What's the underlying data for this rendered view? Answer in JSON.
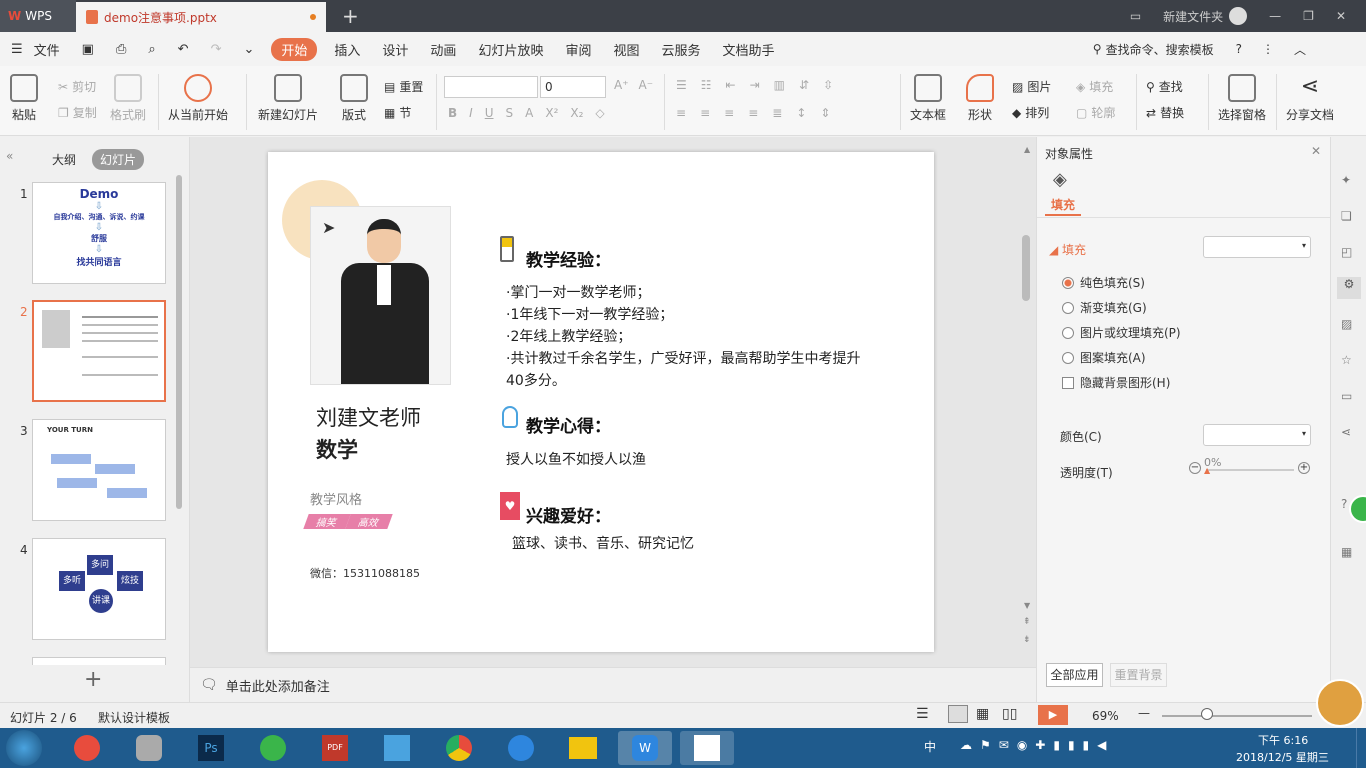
{
  "titlebar": {
    "app": "WPS",
    "doc_tab": "demo注意事项.pptx",
    "new_folder": "新建文件夹"
  },
  "menubar": {
    "file": "文件",
    "items": [
      "开始",
      "插入",
      "设计",
      "动画",
      "幻灯片放映",
      "审阅",
      "视图",
      "云服务",
      "文档助手"
    ],
    "search": "查找命令、搜索模板"
  },
  "ribbon": {
    "paste": "粘贴",
    "cut": "剪切",
    "copy": "复制",
    "format_painter": "格式刷",
    "from_current": "从当前开始",
    "new_slide": "新建幻灯片",
    "layout": "版式",
    "reset": "重置",
    "section": "节",
    "font_size": "0",
    "textbox": "文本框",
    "shape": "形状",
    "picture": "图片",
    "fill": "填充",
    "arrange": "排列",
    "outline": "轮廓",
    "find": "查找",
    "replace": "替换",
    "selection_pane": "选择窗格",
    "share": "分享文档"
  },
  "left_panel": {
    "tab_outline": "大纲",
    "tab_slides": "幻灯片",
    "slides": [
      {
        "num": "1",
        "title": "Demo",
        "line1": "自我介绍、沟通、诉说、约课",
        "line2": "舒服",
        "line3": "找共同语言"
      },
      {
        "num": "2"
      },
      {
        "num": "3",
        "title": "YOUR TURN"
      },
      {
        "num": "4",
        "n1": "多问",
        "n2": "多听",
        "n3": "炫技",
        "n4": "讲课"
      }
    ]
  },
  "slide": {
    "teacher_name": "刘建文老师",
    "subject": "数学",
    "style_label": "教学风格",
    "tag1": "搞笑",
    "tag2": "高效",
    "wechat": "微信：15311088185",
    "exp_heading": "教学经验：",
    "exp_lines": [
      "·掌门一对一数学老师；",
      "·1年线下一对一教学经验；",
      "·2年线上教学经验；",
      "·共计教过千余名学生，广受好评，最高帮助学生中考提升",
      "40多分。"
    ],
    "insight_heading": "教学心得：",
    "insight_text": "授人以鱼不如授人以渔",
    "hobby_heading": "兴趣爱好：",
    "hobby_text": "篮球、读书、音乐、研究记忆"
  },
  "notes": {
    "placeholder": "单击此处添加备注"
  },
  "right_panel": {
    "title": "对象属性",
    "tab_fill": "填充",
    "section_fill": "填充",
    "options": [
      "纯色填充(S)",
      "渐变填充(G)",
      "图片或纹理填充(P)",
      "图案填充(A)"
    ],
    "hide_bg": "隐藏背景图形(H)",
    "color_label": "颜色(C)",
    "transparency_label": "透明度(T)",
    "transparency_value": "0%",
    "apply_all": "全部应用",
    "reset_bg": "重置背景"
  },
  "status": {
    "slide_info": "幻灯片 2 / 6",
    "template": "默认设计模板",
    "zoom": "69%"
  },
  "taskbar": {
    "time": "下午 6:16",
    "date": "2018/12/5 星期三",
    "ime": "中"
  },
  "colors": {
    "accent": "#e8724a",
    "titlebar": "#3c4047",
    "taskbar": "#1f5b8d",
    "tag_pink": "#e77fa8"
  }
}
